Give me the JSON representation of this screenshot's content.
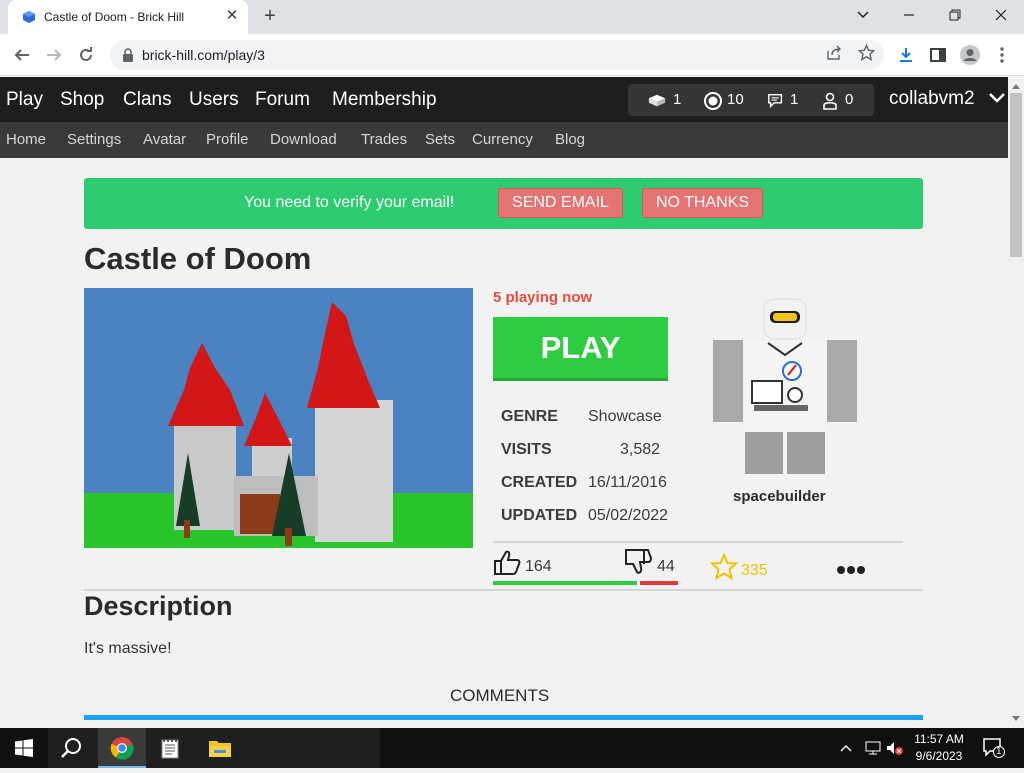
{
  "browser": {
    "tab_title": "Castle of Doom - Brick Hill",
    "tab_close": "✕",
    "new_tab": "+",
    "url": "brick-hill.com/play/3"
  },
  "site": {
    "main_nav": [
      "Play",
      "Shop",
      "Clans",
      "Users",
      "Forum",
      "Membership"
    ],
    "sub_nav": [
      "Home",
      "Settings",
      "Avatar",
      "Profile",
      "Download",
      "Trades",
      "Sets",
      "Currency",
      "Blog"
    ],
    "stats": {
      "bricks": "1",
      "bits": "10",
      "messages": "1",
      "friends": "0"
    },
    "username": "collabvm2"
  },
  "banner": {
    "message": "You need to verify your email!",
    "send_label": "SEND EMAIL",
    "dismiss_label": "NO THANKS"
  },
  "game": {
    "title": "Castle of Doom",
    "playing": "5 playing now",
    "play_label": "PLAY",
    "info": [
      {
        "label": "GENRE",
        "value": "Showcase"
      },
      {
        "label": "VISITS",
        "value": "3,582"
      },
      {
        "label": "CREATED",
        "value": "16/11/2016"
      },
      {
        "label": "UPDATED",
        "value": "05/02/2022"
      }
    ],
    "creator": "spacebuilder",
    "likes": "164",
    "dislikes": "44",
    "like_ratio": 0.79,
    "favorites": "335",
    "description_heading": "Description",
    "description": "It's massive!",
    "comments_heading": "COMMENTS"
  },
  "taskbar": {
    "time": "11:57 AM",
    "date": "9/6/2023",
    "notifications": "1"
  },
  "colors": {
    "accent_green": "#2ecc40",
    "banner_green": "#2ecc71",
    "danger_red": "#e74c3c",
    "fav_yellow": "#f2c200",
    "comments_blue": "#1da1f2"
  },
  "icons": [
    "chrome-favicon-icon",
    "back-icon",
    "forward-icon",
    "reload-icon",
    "lock-icon",
    "share-icon",
    "star-icon",
    "download-icon",
    "sidepanel-icon",
    "profile-icon",
    "menu-icon",
    "bricks-icon",
    "bits-icon",
    "messages-icon",
    "friends-icon",
    "thumbs-up-icon",
    "thumbs-down-icon",
    "favorite-star-icon",
    "more-icon",
    "windows-start-icon",
    "search-icon",
    "chrome-icon",
    "notepad-icon",
    "file-explorer-icon"
  ]
}
